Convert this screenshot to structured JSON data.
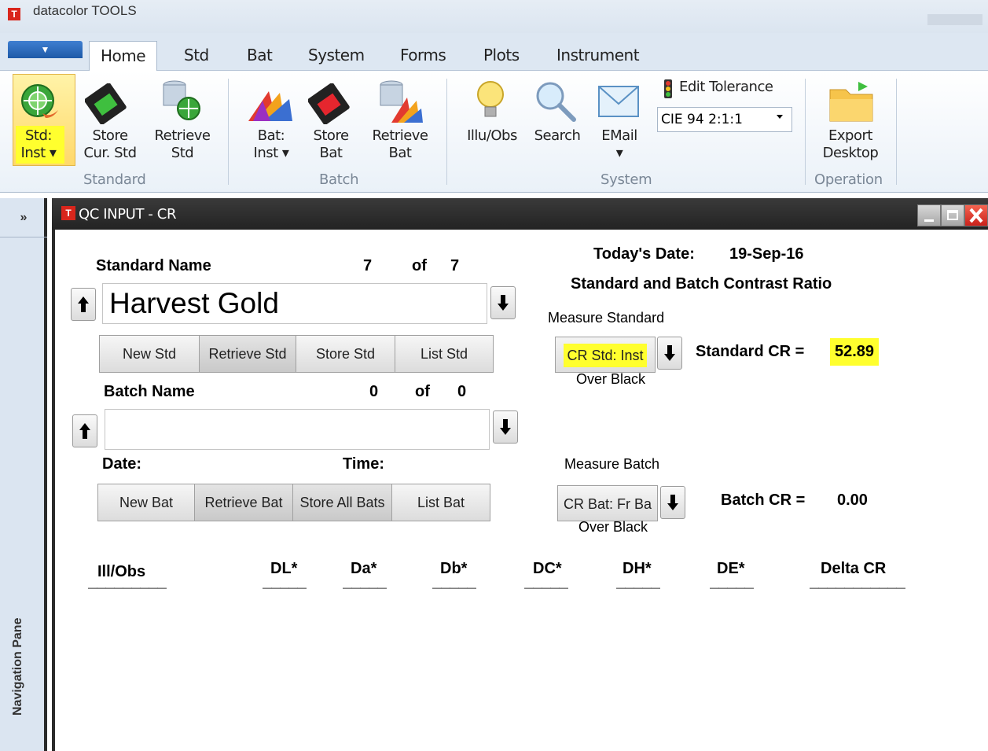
{
  "app": {
    "title": "datacolor TOOLS",
    "logo_text": "T"
  },
  "ribbon": {
    "file_arrow": "▼",
    "tabs": [
      "Home",
      "Std",
      "Bat",
      "System",
      "Forms",
      "Plots",
      "Instrument"
    ],
    "active_tab": "Home",
    "buttons": {
      "std_inst": {
        "line1": "Std:",
        "line2": "Inst ▾"
      },
      "store_cur_std": {
        "line1": "Store",
        "line2": "Cur. Std"
      },
      "retrieve_std": {
        "line1": "Retrieve",
        "line2": "Std"
      },
      "bat_inst": {
        "line1": "Bat:",
        "line2": "Inst ▾"
      },
      "store_bat": {
        "line1": "Store",
        "line2": "Bat"
      },
      "retrieve_bat": {
        "line1": "Retrieve",
        "line2": "Bat"
      },
      "illu_obs": {
        "line1": "Illu/Obs"
      },
      "search": {
        "line1": "Search"
      },
      "email": {
        "line1": "EMail",
        "line2": "▾"
      },
      "edit_tolerance": "Edit Tolerance",
      "tolerance_value": "CIE 94 2:1:1",
      "export_desktop": {
        "line1": "Export",
        "line2": "Desktop"
      }
    },
    "groups": [
      "Standard",
      "Batch",
      "System",
      "Operation"
    ]
  },
  "nav": {
    "expand": "»",
    "label": "Navigation Pane"
  },
  "window": {
    "title": "QC INPUT - CR",
    "icon_text": "T"
  },
  "form": {
    "standard_name_label": "Standard Name",
    "std_index": "7",
    "std_of": "of",
    "std_total": "7",
    "standard_name_value": "Harvest Gold",
    "std_buttons": [
      "New Std",
      "Retrieve Std",
      "Store Std",
      "List Std"
    ],
    "batch_name_label": "Batch Name",
    "bat_index": "0",
    "bat_of": "of",
    "bat_total": "0",
    "batch_name_value": "",
    "date_label": "Date:",
    "time_label": "Time:",
    "bat_buttons": [
      "New Bat",
      "Retrieve Bat",
      "Store All Bats",
      "List Bat"
    ],
    "todays_date_label": "Today's Date:",
    "todays_date_value": "19-Sep-16",
    "contrast_heading": "Standard and Batch Contrast Ratio",
    "measure_standard_label": "Measure Standard",
    "cr_std_button": "CR Std: Inst",
    "cr_std_sub": "Over Black",
    "standard_cr_label": "Standard CR =",
    "standard_cr_value": "52.89",
    "measure_batch_label": "Measure Batch",
    "cr_bat_button": "CR Bat: Fr Ba",
    "cr_bat_sub": "Over Black",
    "batch_cr_label": "Batch CR =",
    "batch_cr_value": "0.00",
    "arrow_up": "🠕",
    "arrow_down": "🠗"
  },
  "results_table": {
    "columns": [
      "Ill/Obs",
      "DL*",
      "Da*",
      "Db*",
      "DC*",
      "DH*",
      "DE*",
      "Delta CR"
    ],
    "rows": []
  },
  "colors": {
    "highlight": "#ffff2e",
    "title_bar": "#2a2a2a",
    "close_button": "#d9261c"
  }
}
